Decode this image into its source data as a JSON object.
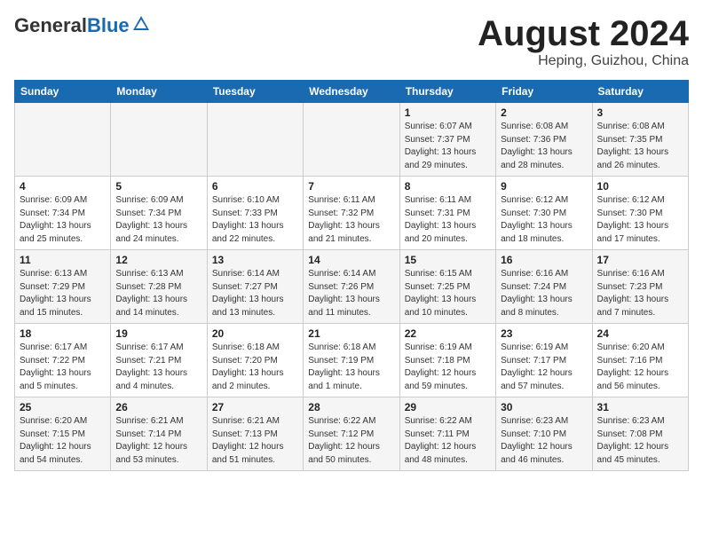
{
  "header": {
    "logo_general": "General",
    "logo_blue": "Blue",
    "title": "August 2024",
    "location": "Heping, Guizhou, China"
  },
  "days_of_week": [
    "Sunday",
    "Monday",
    "Tuesday",
    "Wednesday",
    "Thursday",
    "Friday",
    "Saturday"
  ],
  "weeks": [
    [
      {
        "day": "",
        "info": ""
      },
      {
        "day": "",
        "info": ""
      },
      {
        "day": "",
        "info": ""
      },
      {
        "day": "",
        "info": ""
      },
      {
        "day": "1",
        "info": "Sunrise: 6:07 AM\nSunset: 7:37 PM\nDaylight: 13 hours\nand 29 minutes."
      },
      {
        "day": "2",
        "info": "Sunrise: 6:08 AM\nSunset: 7:36 PM\nDaylight: 13 hours\nand 28 minutes."
      },
      {
        "day": "3",
        "info": "Sunrise: 6:08 AM\nSunset: 7:35 PM\nDaylight: 13 hours\nand 26 minutes."
      }
    ],
    [
      {
        "day": "4",
        "info": "Sunrise: 6:09 AM\nSunset: 7:34 PM\nDaylight: 13 hours\nand 25 minutes."
      },
      {
        "day": "5",
        "info": "Sunrise: 6:09 AM\nSunset: 7:34 PM\nDaylight: 13 hours\nand 24 minutes."
      },
      {
        "day": "6",
        "info": "Sunrise: 6:10 AM\nSunset: 7:33 PM\nDaylight: 13 hours\nand 22 minutes."
      },
      {
        "day": "7",
        "info": "Sunrise: 6:11 AM\nSunset: 7:32 PM\nDaylight: 13 hours\nand 21 minutes."
      },
      {
        "day": "8",
        "info": "Sunrise: 6:11 AM\nSunset: 7:31 PM\nDaylight: 13 hours\nand 20 minutes."
      },
      {
        "day": "9",
        "info": "Sunrise: 6:12 AM\nSunset: 7:30 PM\nDaylight: 13 hours\nand 18 minutes."
      },
      {
        "day": "10",
        "info": "Sunrise: 6:12 AM\nSunset: 7:30 PM\nDaylight: 13 hours\nand 17 minutes."
      }
    ],
    [
      {
        "day": "11",
        "info": "Sunrise: 6:13 AM\nSunset: 7:29 PM\nDaylight: 13 hours\nand 15 minutes."
      },
      {
        "day": "12",
        "info": "Sunrise: 6:13 AM\nSunset: 7:28 PM\nDaylight: 13 hours\nand 14 minutes."
      },
      {
        "day": "13",
        "info": "Sunrise: 6:14 AM\nSunset: 7:27 PM\nDaylight: 13 hours\nand 13 minutes."
      },
      {
        "day": "14",
        "info": "Sunrise: 6:14 AM\nSunset: 7:26 PM\nDaylight: 13 hours\nand 11 minutes."
      },
      {
        "day": "15",
        "info": "Sunrise: 6:15 AM\nSunset: 7:25 PM\nDaylight: 13 hours\nand 10 minutes."
      },
      {
        "day": "16",
        "info": "Sunrise: 6:16 AM\nSunset: 7:24 PM\nDaylight: 13 hours\nand 8 minutes."
      },
      {
        "day": "17",
        "info": "Sunrise: 6:16 AM\nSunset: 7:23 PM\nDaylight: 13 hours\nand 7 minutes."
      }
    ],
    [
      {
        "day": "18",
        "info": "Sunrise: 6:17 AM\nSunset: 7:22 PM\nDaylight: 13 hours\nand 5 minutes."
      },
      {
        "day": "19",
        "info": "Sunrise: 6:17 AM\nSunset: 7:21 PM\nDaylight: 13 hours\nand 4 minutes."
      },
      {
        "day": "20",
        "info": "Sunrise: 6:18 AM\nSunset: 7:20 PM\nDaylight: 13 hours\nand 2 minutes."
      },
      {
        "day": "21",
        "info": "Sunrise: 6:18 AM\nSunset: 7:19 PM\nDaylight: 13 hours\nand 1 minute."
      },
      {
        "day": "22",
        "info": "Sunrise: 6:19 AM\nSunset: 7:18 PM\nDaylight: 12 hours\nand 59 minutes."
      },
      {
        "day": "23",
        "info": "Sunrise: 6:19 AM\nSunset: 7:17 PM\nDaylight: 12 hours\nand 57 minutes."
      },
      {
        "day": "24",
        "info": "Sunrise: 6:20 AM\nSunset: 7:16 PM\nDaylight: 12 hours\nand 56 minutes."
      }
    ],
    [
      {
        "day": "25",
        "info": "Sunrise: 6:20 AM\nSunset: 7:15 PM\nDaylight: 12 hours\nand 54 minutes."
      },
      {
        "day": "26",
        "info": "Sunrise: 6:21 AM\nSunset: 7:14 PM\nDaylight: 12 hours\nand 53 minutes."
      },
      {
        "day": "27",
        "info": "Sunrise: 6:21 AM\nSunset: 7:13 PM\nDaylight: 12 hours\nand 51 minutes."
      },
      {
        "day": "28",
        "info": "Sunrise: 6:22 AM\nSunset: 7:12 PM\nDaylight: 12 hours\nand 50 minutes."
      },
      {
        "day": "29",
        "info": "Sunrise: 6:22 AM\nSunset: 7:11 PM\nDaylight: 12 hours\nand 48 minutes."
      },
      {
        "day": "30",
        "info": "Sunrise: 6:23 AM\nSunset: 7:10 PM\nDaylight: 12 hours\nand 46 minutes."
      },
      {
        "day": "31",
        "info": "Sunrise: 6:23 AM\nSunset: 7:08 PM\nDaylight: 12 hours\nand 45 minutes."
      }
    ]
  ]
}
